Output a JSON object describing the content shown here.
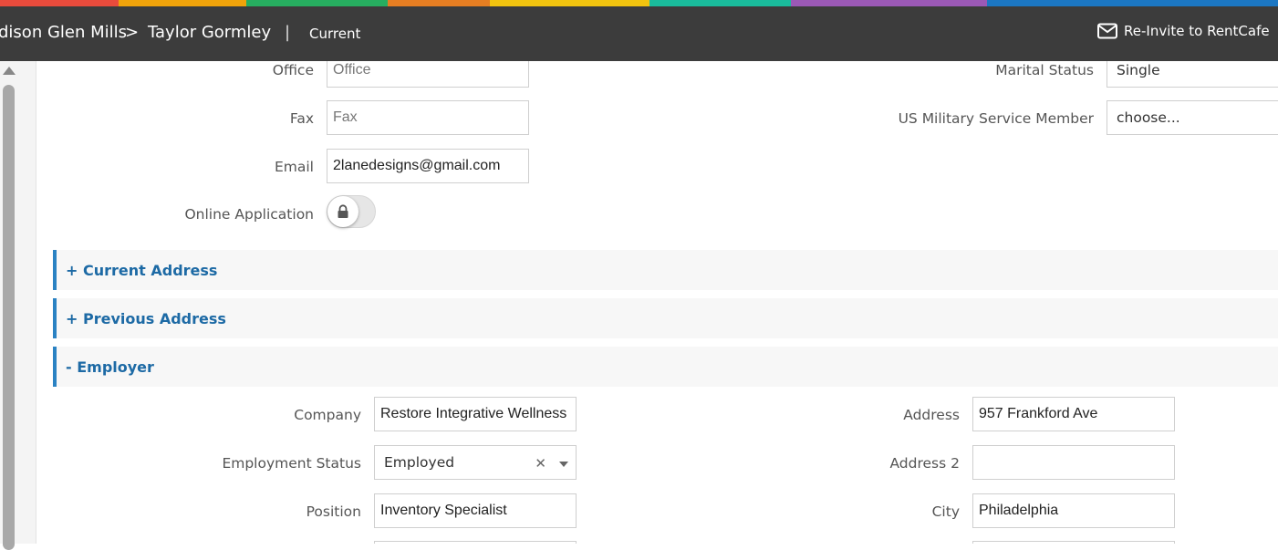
{
  "colors": {
    "rainbow": [
      "#e94b3c",
      "#f0a30a",
      "#f5d10a",
      "#27ae60",
      "#e67e22",
      "#f1c40f",
      "#1abc9c",
      "#9b59b6"
    ],
    "header_bg": "#3c3c3c",
    "section_accent": "#2a82c3",
    "section_text": "#1d6aa5"
  },
  "header": {
    "breadcrumb_property": "dison Glen Mills",
    "breadcrumb_separator": ">",
    "breadcrumb_person": "Taylor Gormley",
    "divider": "|",
    "status": "Current",
    "reinvite_label": "Re-Invite to RentCafe",
    "reinvite_icon": "envelope-icon"
  },
  "contact": {
    "office_label": "Office",
    "office_placeholder": "Office",
    "fax_label": "Fax",
    "fax_placeholder": "Fax",
    "email_label": "Email",
    "email_value": "2lanedesigns@gmail.com",
    "online_app_label": "Online Application",
    "online_app_locked": true
  },
  "personal": {
    "marital_label": "Marital Status",
    "marital_value": "Single",
    "military_label": "US Military Service Member",
    "military_value": "choose..."
  },
  "sections": {
    "current_address": "+ Current Address",
    "previous_address": "+ Previous Address",
    "employer": "- Employer"
  },
  "employer": {
    "company_label": "Company",
    "company_value": "Restore Integrative Wellness C",
    "status_label": "Employment Status",
    "status_value": "Employed",
    "position_label": "Position",
    "position_value": "Inventory Specialist",
    "address_label": "Address",
    "address_value": "957 Frankford Ave",
    "address2_label": "Address 2",
    "address2_value": "",
    "city_label": "City",
    "city_value": "Philadelphia"
  }
}
